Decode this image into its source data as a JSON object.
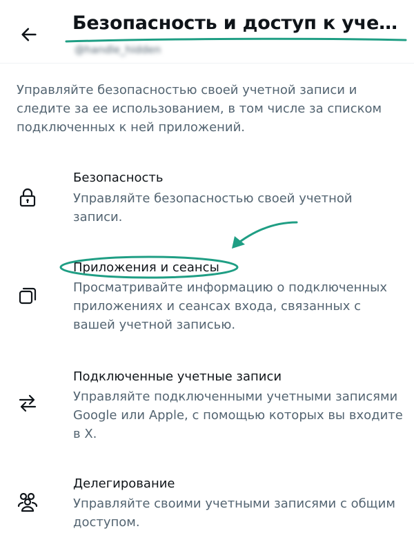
{
  "header": {
    "title": "Безопасность и доступ к учетной записи",
    "handle": "@handle_hidden",
    "back_icon": "arrow-left-icon"
  },
  "intro": "Управляйте безопасностью своей учетной записи и следите за ее использованием, в том числе за списком подключенных к ней приложений.",
  "items": [
    {
      "icon": "lock-icon",
      "label": "Безопасность",
      "description": "Управляйте безопасностью своей учетной записи."
    },
    {
      "icon": "apps-icon",
      "label": "Приложения и сеансы",
      "description": "Просматривайте информацию о подключенных приложениях и сеансах входа, связанных с вашей учетной записью."
    },
    {
      "icon": "swap-arrows-icon",
      "label": "Подключенные учетные записи",
      "description": "Управляйте подключенными учетными записями Google или Apple, с помощью которых вы входите в X."
    },
    {
      "icon": "people-icon",
      "label": "Делегирование",
      "description": "Управляйте своими учетными записями с общим доступом."
    }
  ],
  "colors": {
    "annotation": "#1f9e84",
    "text_primary": "#0f1419",
    "text_secondary": "#536471"
  }
}
